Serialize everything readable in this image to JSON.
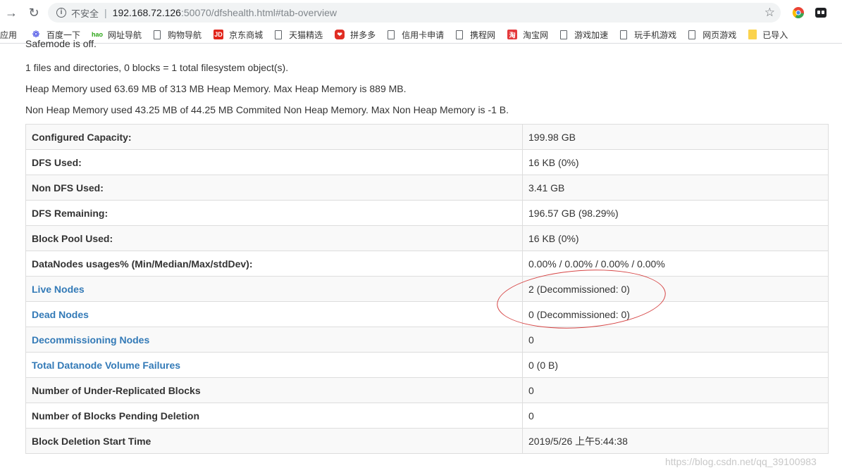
{
  "browser": {
    "url_insecure_label": "不安全",
    "url_host": "192.168.72.126",
    "url_rest": ":50070/dfshealth.html#tab-overview",
    "bookmarks": [
      {
        "label": "应用",
        "icon": "apps"
      },
      {
        "label": "百度一下",
        "icon": "baidu"
      },
      {
        "label": "网址导航",
        "icon": "hao"
      },
      {
        "label": "购物导航",
        "icon": "doc"
      },
      {
        "label": "京东商城",
        "icon": "jd"
      },
      {
        "label": "天猫精选",
        "icon": "doc"
      },
      {
        "label": "拼多多",
        "icon": "pdd"
      },
      {
        "label": "信用卡申请",
        "icon": "doc"
      },
      {
        "label": "携程网",
        "icon": "doc"
      },
      {
        "label": "淘宝网",
        "icon": "taobao"
      },
      {
        "label": "游戏加速",
        "icon": "doc"
      },
      {
        "label": "玩手机游戏",
        "icon": "doc"
      },
      {
        "label": "网页游戏",
        "icon": "doc"
      },
      {
        "label": "已导入",
        "icon": "folder"
      }
    ]
  },
  "page": {
    "cut_text": "Safemode is off.",
    "files_summary": "1 files and directories, 0 blocks = 1 total filesystem object(s).",
    "heap_memory": "Heap Memory used 63.69 MB of 313 MB Heap Memory. Max Heap Memory is 889 MB.",
    "non_heap_memory": "Non Heap Memory used 43.25 MB of 44.25 MB Commited Non Heap Memory. Max Non Heap Memory is -1 B.",
    "rows": [
      {
        "key": "Configured Capacity:",
        "value": "199.98 GB",
        "link": false
      },
      {
        "key": "DFS Used:",
        "value": "16 KB (0%)",
        "link": false
      },
      {
        "key": "Non DFS Used:",
        "value": "3.41 GB",
        "link": false
      },
      {
        "key": "DFS Remaining:",
        "value": "196.57 GB (98.29%)",
        "link": false
      },
      {
        "key": "Block Pool Used:",
        "value": "16 KB (0%)",
        "link": false
      },
      {
        "key": "DataNodes usages% (Min/Median/Max/stdDev):",
        "value": "0.00% / 0.00% / 0.00% / 0.00%",
        "link": false
      },
      {
        "key": "Live Nodes",
        "value": "2 (Decommissioned: 0)",
        "link": true
      },
      {
        "key": "Dead Nodes",
        "value": "0 (Decommissioned: 0)",
        "link": true
      },
      {
        "key": "Decommissioning Nodes",
        "value": "0",
        "link": true
      },
      {
        "key": "Total Datanode Volume Failures",
        "value": "0 (0 B)",
        "link": true
      },
      {
        "key": "Number of Under-Replicated Blocks",
        "value": "0",
        "link": false
      },
      {
        "key": "Number of Blocks Pending Deletion",
        "value": "0",
        "link": false
      },
      {
        "key": "Block Deletion Start Time",
        "value": "2019/5/26 上午5:44:38",
        "link": false
      }
    ]
  },
  "watermark": "https://blog.csdn.net/qq_39100983"
}
